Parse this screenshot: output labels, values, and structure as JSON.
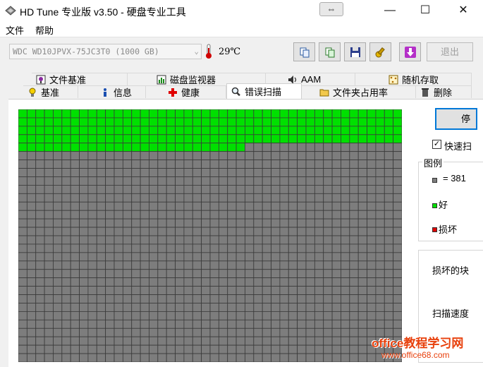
{
  "window": {
    "title": "HD Tune 专业版 v3.50 - 硬盘专业工具",
    "restore_tool_glyph": "⇔",
    "minimize_glyph": "—",
    "maximize_glyph": "☐",
    "close_glyph": "✕"
  },
  "menu": {
    "file": "文件",
    "help": "帮助"
  },
  "toolbar": {
    "drive": "WDC    WD10JPVX-75JC3T0 (1000 GB)",
    "drive_arrow": "⌄",
    "temperature": "29℃",
    "exit_label": "退出"
  },
  "tabs": {
    "file_benchmark": "文件基准",
    "disk_monitor": "磁盘监视器",
    "aam": "AAM",
    "random_access": "随机存取",
    "benchmark": "基准",
    "info": "信息",
    "health": "健康",
    "error_scan": "错误扫描",
    "folder_usage": "文件夹占用率",
    "delete": "删除"
  },
  "scan": {
    "stop_label": "停",
    "quick_scan_check": "✓",
    "quick_scan_label": "快速扫",
    "legend_title": "图例",
    "legend_block": "= 381",
    "legend_good": "好",
    "legend_bad": "损坏",
    "damaged_blocks_label": "损坏的块",
    "scan_speed_label": "扫描速度",
    "grid_cols": 44,
    "grid_rows": 30,
    "good_blocks_scanned": 202
  },
  "colors": {
    "good": "#00e000",
    "unscanned": "#7d7d7d",
    "bad": "#e00000",
    "grid_line": "#3a3a3a",
    "accent": "#0078d7",
    "watermark": "#e8400c"
  },
  "watermark": {
    "line1": "office教程学习网",
    "line2": "www.office68.com"
  }
}
